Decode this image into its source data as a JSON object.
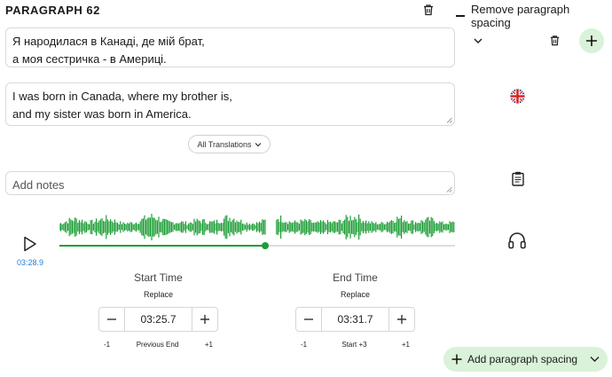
{
  "header": {
    "title": "PARAGRAPH 62",
    "remove_spacing_label": "Remove paragraph spacing"
  },
  "original_text": {
    "line1": "Я народилася в Канаді, де мій брат,",
    "line2": "а моя сестричка - в Америці."
  },
  "translation_text": {
    "line1": "I was born in Canada, where my brother is,",
    "line2": "and my sister was born in America."
  },
  "all_translations_label": "All Translations",
  "notes": {
    "placeholder": "Add notes"
  },
  "player": {
    "current_time": "03:28.9",
    "progress": 0.52,
    "accent": "#1e9e37"
  },
  "start_time": {
    "label": "Start Time",
    "replace_label": "Replace",
    "value": "03:25.7",
    "minus_label": "-1",
    "middle_label": "Previous End",
    "plus_label": "+1"
  },
  "end_time": {
    "label": "End Time",
    "replace_label": "Replace",
    "value": "03:31.7",
    "minus_label": "-1",
    "middle_label": "Start +3",
    "plus_label": "+1"
  },
  "add_spacing_label": "Add paragraph spacing",
  "icons": [
    "trash-icon",
    "minus-icon",
    "chevron-down-icon",
    "plus-icon",
    "uk-flag-icon",
    "clipboard-icon",
    "headphones-icon",
    "play-icon",
    "resize-handle-icon"
  ],
  "colors": {
    "accent_green": "#1e9e37",
    "light_green": "#d9f2d9",
    "time_blue": "#2b7cd3"
  }
}
